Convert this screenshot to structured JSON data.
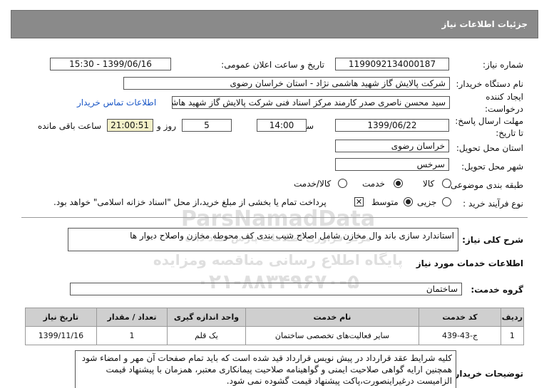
{
  "header": {
    "title": "جزئیات اطلاعات نیاز"
  },
  "labels": {
    "need_number": "شماره نیاز:",
    "announce_datetime": "تاریخ و ساعت اعلان عمومی:",
    "buyer_org": "نام دستگاه خریدار:",
    "creator_line1": "ایجاد کننده",
    "creator_line2": "درخواست:",
    "deadline_line1": "مهلت ارسال پاسخ:",
    "deadline_line2": "تا تاریخ:",
    "time": "ساعت",
    "days_and": "روز و",
    "remaining": "ساعت باقی مانده",
    "province": "استان محل تحویل:",
    "city": "شهر محل تحویل:",
    "category": "طبقه بندی موضوعی:",
    "purchase_type": "نوع فرآیند خرید :",
    "description": "شرح کلی نیاز:",
    "services_info": "اطلاعات خدمات مورد نیاز",
    "service_group": "گروه خدمت:",
    "buyer_notes": "توضیحات خریدار:"
  },
  "values": {
    "need_number": "1199092134000187",
    "announce_datetime": "1399/06/16 - 15:30",
    "buyer_org": "شرکت پالایش گاز شهید هاشمی نژاد - استان خراسان رضوی",
    "creator": "سید محسن  ناصری صدر کارمند مرکز اسناد فنی شرکت پالایش گاز شهید هاشمی",
    "contact_link": "اطلاعات تماس خریدار",
    "deadline_date": "1399/06/22",
    "deadline_time": "14:00",
    "days": "5",
    "remaining_time": "21:00:51",
    "province": "خراسان رضوی",
    "city": "سرخس",
    "description": "استاندارد سازی باند وال مخازن شامل اصلاح شیب بندی کف محوطه مخازن واصلاح دیوار ها",
    "service_group": "ساختمان",
    "buyer_notes": "کلیه شرایط عقد قرارداد در پیش نویس قرارداد قید شده است که باید تمام صفحات آن مهر و امضاء شود همچنین ارایه گواهی صلاحیت ایمنی و گواهینامه صلاحیت پیمانکاری معتبر، همزمان با پیشنهاد قیمت الزامیست درغیراینصورت،پاکت پیشنهاد قیمت گشوده نمی شود."
  },
  "category_options": [
    {
      "label": "کالا",
      "selected": false
    },
    {
      "label": "خدمت",
      "selected": true
    },
    {
      "label": "کالا/خدمت",
      "selected": false
    }
  ],
  "purchase_options": [
    {
      "label": "جزیی",
      "selected": false
    },
    {
      "label": "متوسط",
      "selected": true
    }
  ],
  "payment_note": "پرداخت تمام یا بخشی از مبلغ خرید،از محل \"اسناد خزانه اسلامی\" خواهد بود.",
  "payment_checked": true,
  "table": {
    "headers": [
      "ردیف",
      "کد خدمت",
      "نام خدمت",
      "واحد اندازه گیری",
      "تعداد / مقدار",
      "تاریخ نیاز"
    ],
    "rows": [
      [
        "1",
        "ج-43-439",
        "سایر فعالیت‌های تخصصی ساختمان",
        "یک قلم",
        "1",
        "1399/11/16"
      ]
    ]
  },
  "watermark": {
    "brand": "ParsNamadData",
    "line1": "مرکز فراوری اطلاعات پارس نماد داده",
    "line2": "پایگاه اطلاع رسانی مناقصه ومزایده",
    "phone": "۰۲۱-۸۸۳۴۹۶۷۰-۵"
  }
}
